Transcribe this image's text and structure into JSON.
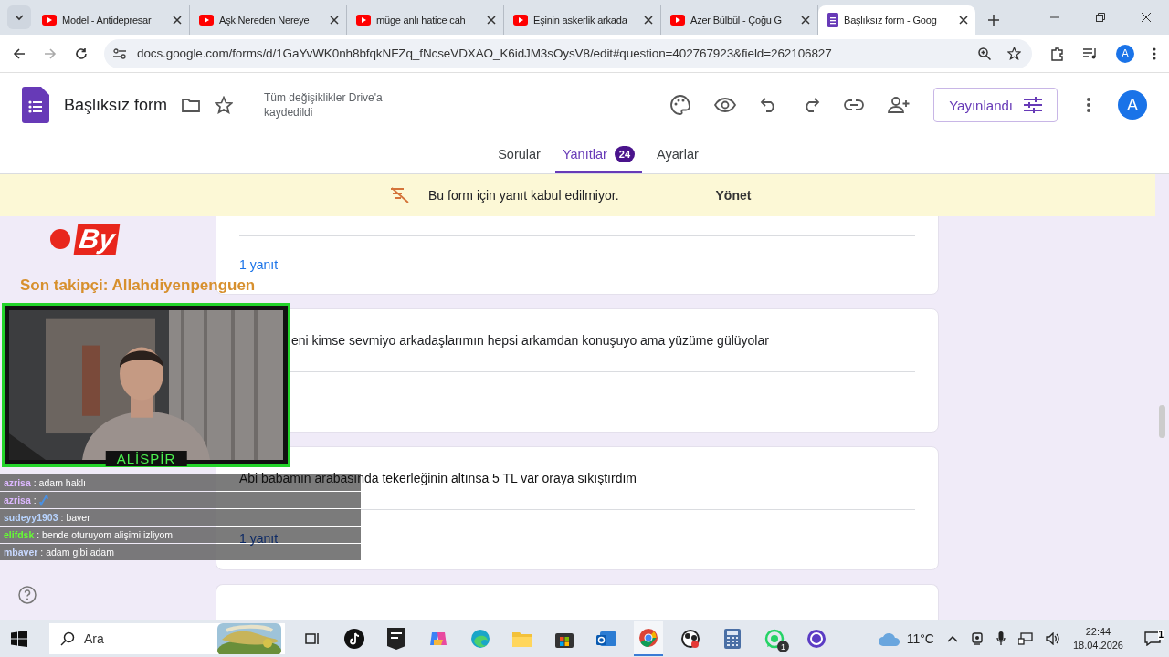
{
  "browser_tabs": [
    {
      "title": "Model - Antidepresar",
      "kind": "video",
      "selected": false
    },
    {
      "title": "Aşk Nereden Nereye",
      "kind": "video",
      "selected": false
    },
    {
      "title": "müge anlı hatice cah",
      "kind": "video",
      "selected": false
    },
    {
      "title": "Eşinin askerlik arkada",
      "kind": "video",
      "selected": false
    },
    {
      "title": "Azer Bülbül - Çoğu G",
      "kind": "video",
      "selected": false
    },
    {
      "title": "Başlıksız form - Goog",
      "kind": "form",
      "selected": true
    }
  ],
  "address_bar": {
    "url": "docs.google.com/forms/d/1GaYvWK0nh8bfqkNFZq_fNcseVDXAO_K6idJM3sOysV8/edit#question=402767923&field=262106827",
    "profile": "A"
  },
  "form_header": {
    "title": "Başlıksız form",
    "save_status": "Tüm değişiklikler Drive'a kaydedildi",
    "publish_button": "Yayınlandı",
    "avatar": "A"
  },
  "form_tabs": [
    {
      "label": "Sorular",
      "selected": false
    },
    {
      "label": "Yanıtlar",
      "selected": true,
      "badge": "24"
    },
    {
      "label": "Ayarlar",
      "selected": false
    }
  ],
  "banner": {
    "message": "Bu form için yanıt kabul edilmiyor.",
    "action": "Yönet"
  },
  "responses": [
    {
      "count": "1 yanıt"
    },
    {
      "text": "eni kimse sevmiyo arkadaşlarımın hepsi arkamdan konuşuyo ama yüzüme gülüyolar"
    },
    {
      "text": "Abi babamın arabasında tekerleğinin altınsa 5 TL var oraya sıkıştırdım",
      "count": "1 yanıt"
    },
    {
      "kind": "card"
    }
  ],
  "stream_overlay": {
    "logo": "By",
    "follower": "Son takipçi: Allahdiyenpenguen",
    "webcam_name": "ALİSPİR",
    "chat": [
      {
        "user": "azrisa",
        "color": "#dcb8ff",
        "message": ": adam haklı",
        "emote": false
      },
      {
        "user": "azrisa",
        "color": "#dcb8ff",
        "message": ":",
        "emote": true
      },
      {
        "user": "sudeyy1903",
        "color": "#b8d4ff",
        "message": ": baver",
        "emote": false
      },
      {
        "user": "elifdsk",
        "color": "#66ff33",
        "message": ": bende oturuyom alişimi izliyom",
        "emote": false
      },
      {
        "user": "mbaver",
        "color": "#c8d8ff",
        "message": ": adam gibi adam",
        "emote": false
      }
    ]
  },
  "taskbar": {
    "search_placeholder": "Ara",
    "temperature": "11°C",
    "time": "22:44",
    "date": "18.04.2026",
    "whatsapp_badge": "1",
    "notifications": "1"
  }
}
